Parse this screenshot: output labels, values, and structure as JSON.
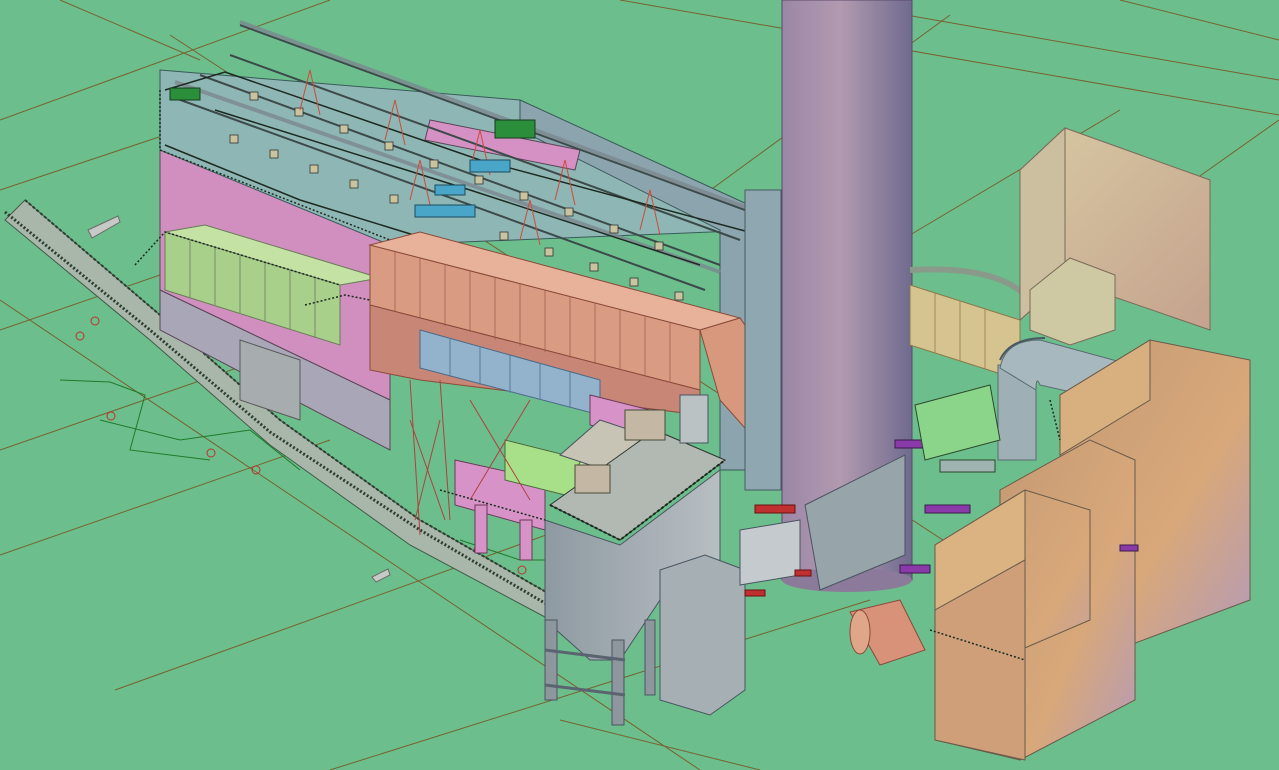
{
  "viewport": {
    "background_color": "#6cbf8c",
    "render_mode": "shaded",
    "view": "isometric"
  },
  "colors": {
    "grid_line": "#7a4a1a",
    "stack": "#9a8aa8",
    "duct": "#d89a7e",
    "precipitator_roof": "#8fb6b6",
    "precipitator_side": "#d590c4",
    "green_equipment": "#a8d88e",
    "scrubber": "#d8aa78",
    "steel_grey": "#9aa2a8",
    "conveyor": "#a8b4a8",
    "railing_dark": "#1c2a20"
  },
  "scene": {
    "objects": [
      "stack-chimney",
      "electrostatic-precipitator",
      "flue-gas-duct",
      "scrubber-modules",
      "ash-silo",
      "inclined-conveyor",
      "absorber-building",
      "elbow-pipe"
    ]
  }
}
